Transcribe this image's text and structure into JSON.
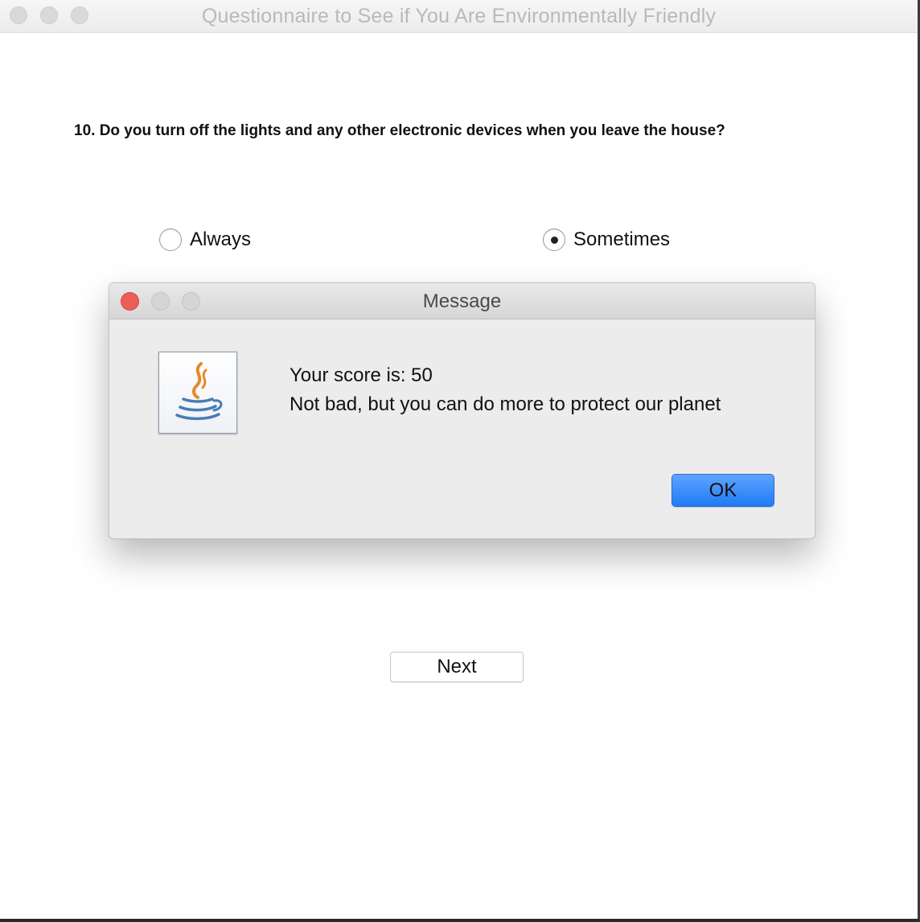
{
  "window": {
    "title": "Questionnaire to See if You Are Environmentally Friendly"
  },
  "question": {
    "text": "10. Do you turn off the lights and any other electronic devices when you leave the house?",
    "options": [
      {
        "label": "Always",
        "selected": false
      },
      {
        "label": "Sometimes",
        "selected": true
      }
    ]
  },
  "buttons": {
    "next_label": "Next"
  },
  "dialog": {
    "title": "Message",
    "icon": "java-coffee-cup-icon",
    "lines": [
      "Your score is: 50",
      "Not bad, but you can do more to protect our planet"
    ],
    "ok_label": "OK"
  },
  "colors": {
    "close_button": "#ec5f57",
    "ok_button": "#1f7cf5"
  }
}
